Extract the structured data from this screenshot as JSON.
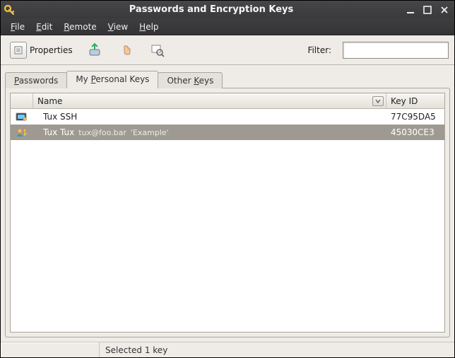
{
  "window": {
    "title": "Passwords and Encryption Keys"
  },
  "menu": {
    "file": "File",
    "edit": "Edit",
    "remote": "Remote",
    "view": "View",
    "help": "Help"
  },
  "toolbar": {
    "properties_label": "Properties",
    "filter_label": "Filter:",
    "filter_value": ""
  },
  "tabs": {
    "passwords": "Passwords",
    "personal": "My Personal Keys",
    "other": "Other Keys",
    "active_index": 1
  },
  "columns": {
    "name": "Name",
    "keyid": "Key ID"
  },
  "keys": [
    {
      "icon": "terminal-key-icon",
      "name": "Tux SSH",
      "email": "",
      "comment": "",
      "keyid": "77C95DA5",
      "selected": false
    },
    {
      "icon": "person-keys-icon",
      "name": "Tux Tux",
      "email": "tux@foo.bar",
      "comment": "'Example'",
      "keyid": "45030CE3",
      "selected": true
    }
  ],
  "status": {
    "text": "Selected 1 key"
  }
}
